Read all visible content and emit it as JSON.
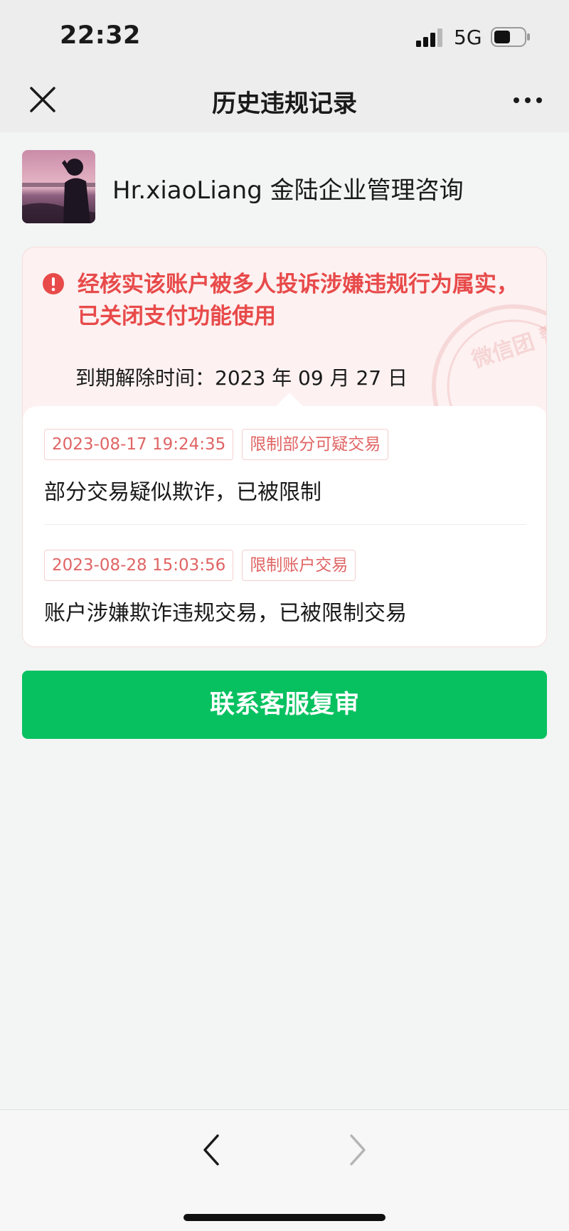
{
  "status_bar": {
    "time": "22:32",
    "network": "5G"
  },
  "nav": {
    "title": "历史违规记录"
  },
  "profile": {
    "name": "Hr.xiaoLiang 金陆企业管理咨询"
  },
  "notice": {
    "message": "经核实该账户被多人投诉涉嫌违规行为属实，已关闭支付功能使用",
    "expiry": "到期解除时间：2023 年 09 月 27 日",
    "stamp_text": "微信团 警告"
  },
  "records": [
    {
      "time": "2023-08-17 19:24:35",
      "tag": "限制部分可疑交易",
      "desc": "部分交易疑似欺诈，已被限制"
    },
    {
      "time": "2023-08-28 15:03:56",
      "tag": "限制账户交易",
      "desc": "账户涉嫌欺诈违规交易，已被限制交易"
    }
  ],
  "action": {
    "label": "联系客服复审"
  },
  "colors": {
    "accent_green": "#07c160",
    "alert_red": "#e84a4a",
    "tag_red": "#e06464"
  },
  "icons": [
    "close-icon",
    "more-icon",
    "alert-icon",
    "back-icon",
    "forward-icon",
    "signal-icon",
    "battery-icon"
  ]
}
